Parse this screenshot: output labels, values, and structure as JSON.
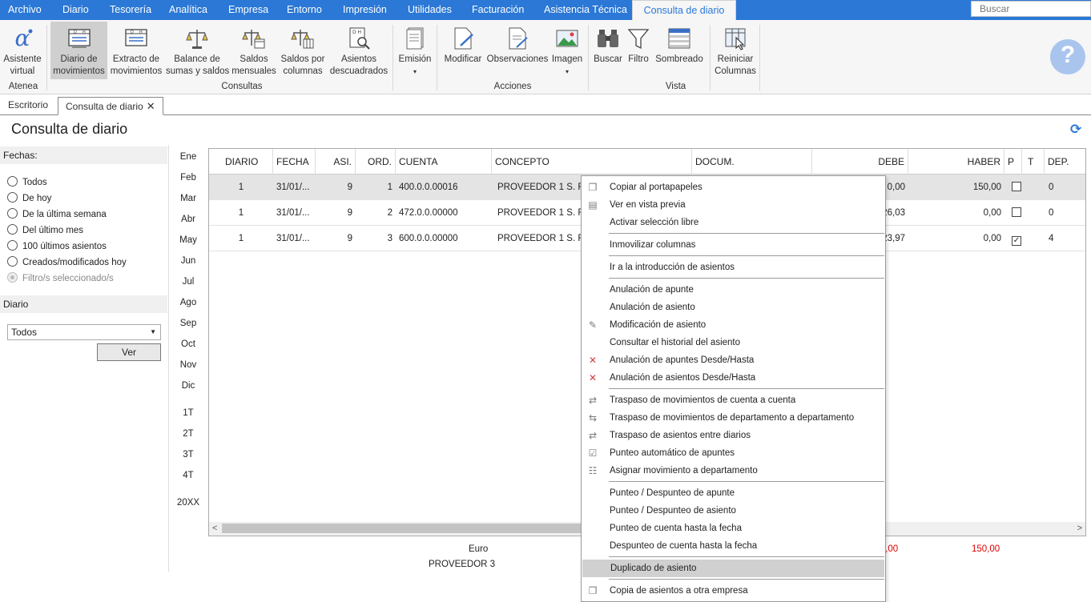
{
  "menubar": {
    "items": [
      "Archivo",
      "Diario",
      "Tesorería",
      "Analítica",
      "Empresa",
      "Entorno",
      "Impresión",
      "Utilidades",
      "Facturación",
      "Asistencia Técnica",
      "Consulta de diario"
    ],
    "active": "Consulta de diario",
    "search_placeholder": "Buscar"
  },
  "ribbon": {
    "buttons": [
      {
        "l1": "Asistente",
        "l2": "virtual",
        "icon": "alpha-icon"
      },
      {
        "l1": "Diario de",
        "l2": "movimientos",
        "icon": "journal-icon"
      },
      {
        "l1": "Extracto de",
        "l2": "movimientos",
        "icon": "ledger-icon"
      },
      {
        "l1": "Balance de",
        "l2": "sumas y saldos",
        "icon": "scale-icon"
      },
      {
        "l1": "Saldos",
        "l2": "mensuales",
        "icon": "scale-calendar-icon"
      },
      {
        "l1": "Saldos por",
        "l2": "columnas",
        "icon": "scale-columns-icon"
      },
      {
        "l1": "Asientos",
        "l2": "descuadrados",
        "icon": "search-doc-icon"
      },
      {
        "l1": "Emisión",
        "l2": "▾",
        "icon": "print-doc-icon"
      },
      {
        "l1": "Modificar",
        "l2": "",
        "icon": "edit-doc-icon"
      },
      {
        "l1": "Observaciones",
        "l2": "",
        "icon": "notes-doc-icon"
      },
      {
        "l1": "Imagen",
        "l2": "▾",
        "icon": "image-icon"
      },
      {
        "l1": "Buscar",
        "l2": "",
        "icon": "binoculars-icon"
      },
      {
        "l1": "Filtro",
        "l2": "",
        "icon": "filter-icon"
      },
      {
        "l1": "Sombreado",
        "l2": "",
        "icon": "shading-icon"
      },
      {
        "l1": "Reiniciar",
        "l2": "Columnas",
        "icon": "reset-columns-icon"
      }
    ],
    "groups": [
      "Atenea",
      "Consultas",
      "Acciones",
      "Vista"
    ]
  },
  "doctabs": {
    "tab1": "Escritorio",
    "tab2": "Consulta de diario",
    "close": "✕"
  },
  "page": {
    "title": "Consulta de diario"
  },
  "filters": {
    "fechas_label": "Fechas:",
    "options": [
      "Todos",
      "De hoy",
      "De la última semana",
      "Del último mes",
      "100 últimos asientos",
      "Creados/modificados hoy",
      "Filtro/s seleccionado/s"
    ],
    "diario_label": "Diario",
    "diario_value": "Todos",
    "ver_button": "Ver"
  },
  "months": [
    "Ene",
    "Feb",
    "Mar",
    "Abr",
    "May",
    "Jun",
    "Jul",
    "Ago",
    "Sep",
    "Oct",
    "Nov",
    "Dic"
  ],
  "quarters": [
    "1T",
    "2T",
    "3T",
    "4T",
    "20XX"
  ],
  "grid": {
    "headers": [
      "DIARIO",
      "FECHA",
      "ASI.",
      "ORD.",
      "CUENTA",
      "CONCEPTO",
      "DOCUM.",
      "DEBE",
      "HABER",
      "P",
      "T",
      "DEP."
    ],
    "rows": [
      {
        "diario": "1",
        "fecha": "31/01/...",
        "asi": "9",
        "ord": "1",
        "cuenta": "400.0.0.00016",
        "concepto": "PROVEEDOR 1 S. FRA",
        "debe": "0,00",
        "haber": "150,00",
        "p": false,
        "dep": "0"
      },
      {
        "diario": "1",
        "fecha": "31/01/...",
        "asi": "9",
        "ord": "2",
        "cuenta": "472.0.0.00000",
        "concepto": "PROVEEDOR 1 S. FRA",
        "debe": "26,03",
        "haber": "0,00",
        "p": false,
        "dep": "0"
      },
      {
        "diario": "1",
        "fecha": "31/01/...",
        "asi": "9",
        "ord": "3",
        "cuenta": "600.0.0.00000",
        "concepto": "PROVEEDOR 1 S. FRA",
        "debe": "123,97",
        "haber": "0,00",
        "p": true,
        "dep": "4"
      }
    ]
  },
  "footer": {
    "currency": "Euro",
    "account_name": "PROVEEDOR 3",
    "debe_total": "150,00",
    "haber_total": "150,00"
  },
  "context_menu": [
    {
      "label": "Copiar al portapapeles",
      "icon": "copy-icon"
    },
    {
      "label": "Ver en vista previa",
      "icon": "preview-icon"
    },
    {
      "label": "Activar selección libre",
      "icon": ""
    },
    {
      "sep": true
    },
    {
      "label": "Inmovilizar columnas",
      "icon": ""
    },
    {
      "sep": true
    },
    {
      "label": "Ir a la introducción de asientos",
      "icon": ""
    },
    {
      "sep": true
    },
    {
      "label": "Anulación de apunte",
      "icon": ""
    },
    {
      "label": "Anulación de asiento",
      "icon": ""
    },
    {
      "label": "Modificación de asiento",
      "icon": "edit-doc-icon"
    },
    {
      "label": "Consultar el historial del asiento",
      "icon": ""
    },
    {
      "label": "Anulación de apuntes Desde/Hasta",
      "icon": "delete-range-icon"
    },
    {
      "label": "Anulación de asientos Desde/Hasta",
      "icon": "delete-range-icon"
    },
    {
      "sep": true
    },
    {
      "label": "Traspaso de movimientos de cuenta a cuenta",
      "icon": "transfer-account-icon"
    },
    {
      "label": "Traspaso de movimientos de departamento a departamento",
      "icon": "transfer-department-icon"
    },
    {
      "label": "Traspaso de asientos entre diarios",
      "icon": "swap-arrows-icon"
    },
    {
      "label": "Punteo automático de apuntes",
      "icon": "checklist-icon"
    },
    {
      "label": "Asignar movimiento a departamento",
      "icon": "hierarchy-icon"
    },
    {
      "sep": true
    },
    {
      "label": "Punteo / Despunteo de apunte",
      "icon": ""
    },
    {
      "label": "Punteo / Despunteo de asiento",
      "icon": ""
    },
    {
      "label": "Punteo de cuenta hasta la fecha",
      "icon": ""
    },
    {
      "label": "Despunteo de cuenta hasta la fecha",
      "icon": ""
    },
    {
      "sep": true
    },
    {
      "label": "Duplicado de asiento",
      "icon": "",
      "highlight": true
    },
    {
      "sep": true
    },
    {
      "label": "Copia de asientos a otra empresa",
      "icon": "copy-company-icon"
    }
  ]
}
